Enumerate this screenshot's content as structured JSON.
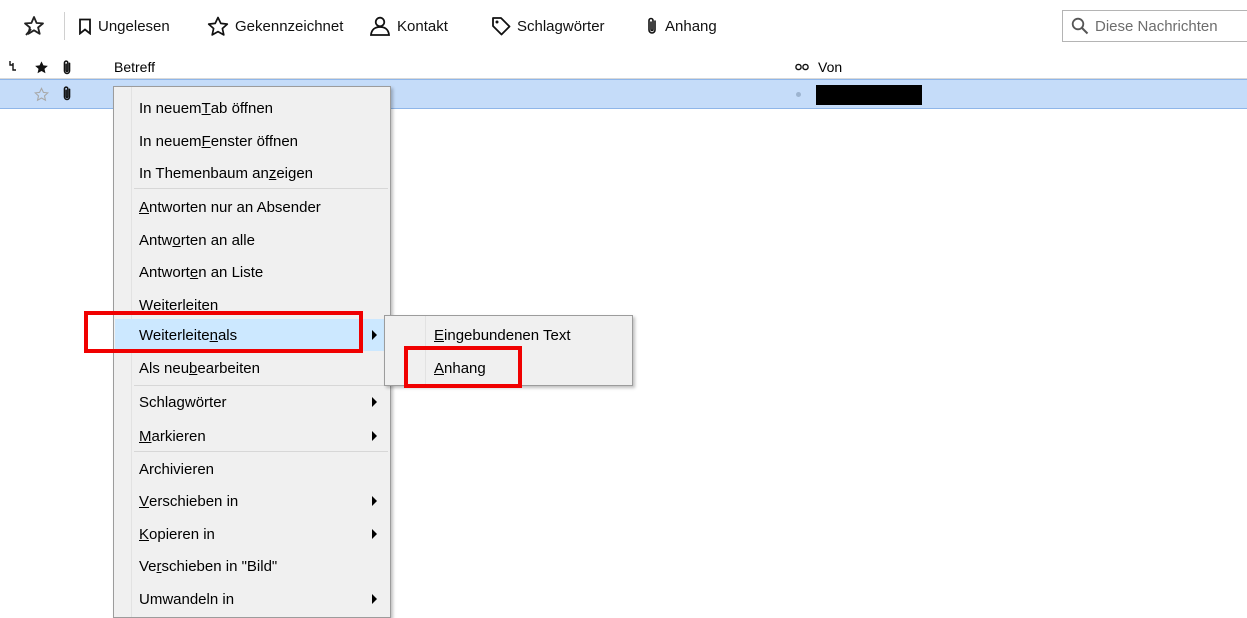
{
  "toolbar": {
    "buttons": [
      {
        "label": "Ungelesen",
        "icon": "bookmark-icon"
      },
      {
        "label": "Gekennzeichnet",
        "icon": "star-outline-icon"
      },
      {
        "label": "Kontakt",
        "icon": "contact-icon"
      },
      {
        "label": "Schlagwörter",
        "icon": "tag-icon"
      },
      {
        "label": "Anhang",
        "icon": "paperclip-icon"
      }
    ],
    "search_placeholder": "Diese Nachrichten"
  },
  "columns": {
    "subject": "Betreff",
    "from": "Von"
  },
  "context_menu": {
    "items": [
      {
        "pre": "In neuem ",
        "acc": "T",
        "post": "ab öffnen"
      },
      {
        "pre": "In neuem ",
        "acc": "F",
        "post": "enster öffnen"
      },
      {
        "pre": "In Themenbaum an",
        "acc": "z",
        "post": "eigen"
      },
      {
        "pre": "",
        "acc": "A",
        "post": "ntworten nur an Absender"
      },
      {
        "pre": "Antw",
        "acc": "o",
        "post": "rten an alle"
      },
      {
        "pre": "Antwort",
        "acc": "e",
        "post": "n an Liste"
      },
      {
        "pre": "",
        "acc": "W",
        "post": "eiterleiten"
      },
      {
        "pre": "Weiterleite",
        "acc": "n",
        "post": " als"
      },
      {
        "pre": "Als neu ",
        "acc": "b",
        "post": "earbeiten"
      },
      {
        "pre": "Schla",
        "acc": "g",
        "post": "wörter"
      },
      {
        "pre": "",
        "acc": "M",
        "post": "arkieren"
      },
      {
        "pre": "Archivieren",
        "acc": "",
        "post": ""
      },
      {
        "pre": "",
        "acc": "V",
        "post": "erschieben in"
      },
      {
        "pre": "",
        "acc": "K",
        "post": "opieren in"
      },
      {
        "pre": "Ve",
        "acc": "r",
        "post": "schieben in \"Bild\""
      },
      {
        "pre": "Umwandeln in",
        "acc": "",
        "post": ""
      }
    ]
  },
  "submenu": {
    "items": [
      {
        "pre": "",
        "acc": "E",
        "post": "ingebundenen Text"
      },
      {
        "pre": "",
        "acc": "A",
        "post": "nhang"
      }
    ]
  },
  "colors": {
    "selection": "#c5dcf9",
    "menu_highlight": "#cce8ff",
    "annotation_red": "#f00000",
    "menu_background": "#f0f0f0"
  }
}
